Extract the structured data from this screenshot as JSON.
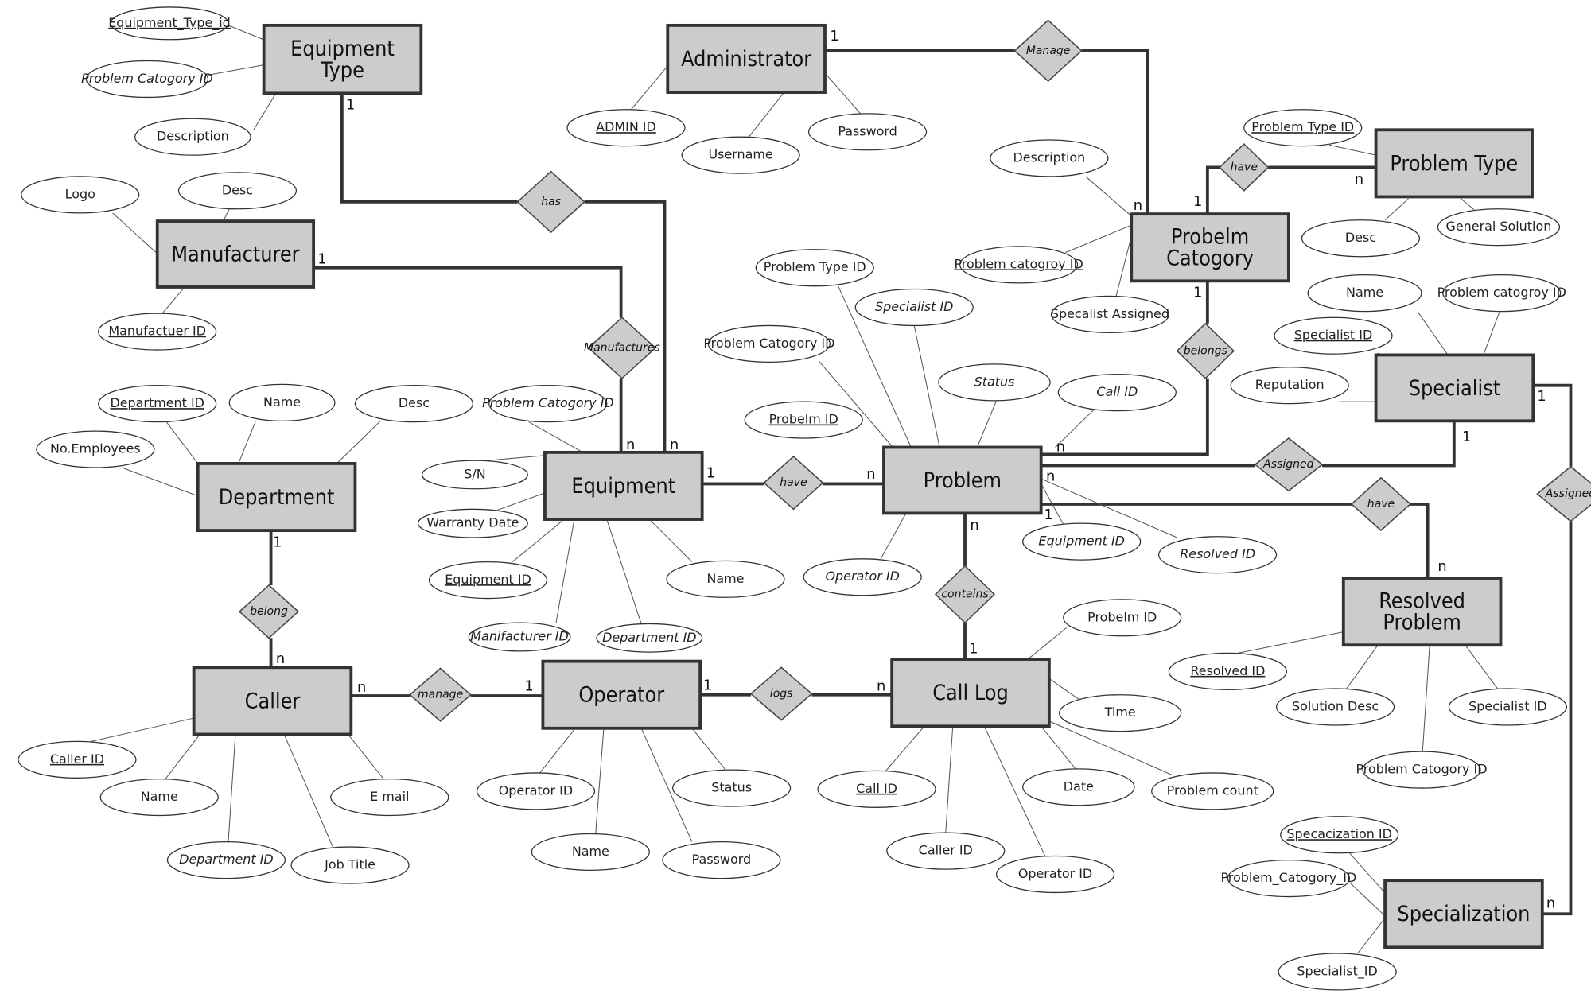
{
  "entities": [
    {
      "name": [
        "Equipment",
        "Type"
      ]
    },
    {
      "name": [
        "Administrator"
      ]
    },
    {
      "name": [
        "Manufacturer"
      ]
    },
    {
      "name": [
        "Probelm",
        "Catogory"
      ]
    },
    {
      "name": [
        "Problem  Type"
      ]
    },
    {
      "name": [
        "Specialist"
      ]
    },
    {
      "name": [
        "Department"
      ]
    },
    {
      "name": [
        "Equipment"
      ]
    },
    {
      "name": [
        "Problem"
      ]
    },
    {
      "name": [
        "Resolved",
        "Problem"
      ]
    },
    {
      "name": [
        "Caller"
      ]
    },
    {
      "name": [
        "Operator"
      ]
    },
    {
      "name": [
        "Call  Log"
      ]
    },
    {
      "name": [
        "Specialization"
      ]
    }
  ],
  "relationships": [
    "has",
    "Manage",
    "Manufactures",
    "have",
    "belongs",
    "Assigned",
    "have",
    "Assigned",
    "have",
    "contains",
    "belong",
    "manage",
    "logs"
  ],
  "attributes": [
    {
      "label": "Equipment_Type_id",
      "style": "key"
    },
    {
      "label": "Problem Catogory ID",
      "style": "italic"
    },
    {
      "label": "Description",
      "style": "plain"
    },
    {
      "label": "ADMIN ID",
      "style": "key"
    },
    {
      "label": "Username",
      "style": "plain"
    },
    {
      "label": "Password",
      "style": "plain"
    },
    {
      "label": "Logo",
      "style": "plain"
    },
    {
      "label": "Desc",
      "style": "plain"
    },
    {
      "label": "Manufactuer ID",
      "style": "key"
    },
    {
      "label": "Department ID",
      "style": "key"
    },
    {
      "label": "Name",
      "style": "plain"
    },
    {
      "label": "Desc",
      "style": "plain"
    },
    {
      "label": "No.Employees",
      "style": "plain"
    },
    {
      "label": "Problem Catogory ID",
      "style": "italic"
    },
    {
      "label": "S/N",
      "style": "plain"
    },
    {
      "label": "Warranty Date",
      "style": "plain"
    },
    {
      "label": "Equipment ID",
      "style": "key"
    },
    {
      "label": "Manifacturer ID",
      "style": "italic"
    },
    {
      "label": "Department ID",
      "style": "italic"
    },
    {
      "label": "Name",
      "style": "plain"
    },
    {
      "label": "Problem Type ID",
      "style": "plain"
    },
    {
      "label": "Specialist ID",
      "style": "italic"
    },
    {
      "label": "Problem Catogory ID",
      "style": "plain"
    },
    {
      "label": "Probelm ID",
      "style": "key"
    },
    {
      "label": "Status",
      "style": "italic"
    },
    {
      "label": "Call ID",
      "style": "italic"
    },
    {
      "label": "Operator ID",
      "style": "italic"
    },
    {
      "label": "Equipment ID",
      "style": "italic"
    },
    {
      "label": "Resolved ID",
      "style": "italic"
    },
    {
      "label": "Description",
      "style": "plain"
    },
    {
      "label": "Problem catogroy ID",
      "style": "key"
    },
    {
      "label": "Specalist Assigned",
      "style": "plain"
    },
    {
      "label": "Problem Type ID",
      "style": "key"
    },
    {
      "label": "Desc",
      "style": "plain"
    },
    {
      "label": "General Solution",
      "style": "plain"
    },
    {
      "label": "Name",
      "style": "plain"
    },
    {
      "label": "Problem catogroy ID",
      "style": "plain"
    },
    {
      "label": "Specialist ID",
      "style": "key"
    },
    {
      "label": "Reputation",
      "style": "plain"
    },
    {
      "label": "Resolved ID",
      "style": "key"
    },
    {
      "label": "Solution Desc",
      "style": "plain"
    },
    {
      "label": "Specialist ID",
      "style": "plain"
    },
    {
      "label": "Problem Catogory ID",
      "style": "plain"
    },
    {
      "label": "Caller ID",
      "style": "key"
    },
    {
      "label": "Name",
      "style": "plain"
    },
    {
      "label": "Department ID",
      "style": "italic"
    },
    {
      "label": "Job Title",
      "style": "plain"
    },
    {
      "label": "E mail",
      "style": "plain"
    },
    {
      "label": "Operator ID",
      "style": "plain"
    },
    {
      "label": "Name",
      "style": "plain"
    },
    {
      "label": "Password",
      "style": "plain"
    },
    {
      "label": "Status",
      "style": "plain"
    },
    {
      "label": "Probelm ID",
      "style": "plain"
    },
    {
      "label": "Time",
      "style": "plain"
    },
    {
      "label": "Date",
      "style": "plain"
    },
    {
      "label": "Problem count",
      "style": "plain"
    },
    {
      "label": "Call ID",
      "style": "key"
    },
    {
      "label": "Caller ID",
      "style": "plain"
    },
    {
      "label": "Operator ID",
      "style": "plain"
    },
    {
      "label": "Specacization ID",
      "style": "key"
    },
    {
      "label": "Problem_Catogory_ID",
      "style": "plain"
    },
    {
      "label": "Specialist_ID",
      "style": "plain"
    }
  ],
  "cardinalities": [
    "1",
    "1",
    "1",
    "n",
    "n",
    "n",
    "1",
    "n",
    "1",
    "n",
    "1",
    "1",
    "n",
    "1",
    "n",
    "1",
    "n",
    "n",
    "1",
    "1",
    "n",
    "n",
    "1",
    "1",
    "n",
    "n"
  ],
  "colors": {
    "entity_fill": "#cccccc",
    "stroke": "#333333"
  }
}
